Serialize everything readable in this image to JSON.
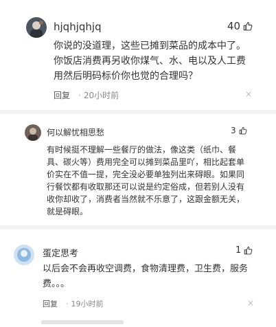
{
  "comments": [
    {
      "username": "hjqhjqhjq",
      "likes": "40",
      "text": "你说的没道理，这些已摊到菜品的成本中了。你饭店消费再另收你煤气、水、电以及人工费用然后明码标价你也觉的合理吗？",
      "reply_label": "回复",
      "separator": "·",
      "time": "20小时前",
      "close": "×"
    },
    {
      "username": "何以解忧相思愁",
      "likes": "3",
      "text": "有时候挺不理解一些餐厅的做法，像这类（纸巾、餐具、碳火等）费用完全可以摊到菜品里吖，相比起套单价实在不值一提，完全没必要单独列出来碍眼。如果同行餐饮都有收取那还可以说是约定俗成，但若别人没有收你却收了，消费者当然就不乐意了，这跟金额无关，就是碍眼。",
      "close": "×"
    },
    {
      "username": "蛋定思考",
      "likes": "1",
      "text": "以后会不会再收空调费，食物清理费，卫生费，服务费。。。",
      "reply_label": "回复",
      "separator": "·",
      "time": "19小时前",
      "close": "×"
    }
  ]
}
